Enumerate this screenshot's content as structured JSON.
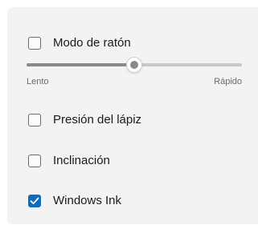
{
  "settings": {
    "mouse_mode": {
      "label": "Modo de ratón",
      "checked": false
    },
    "speed_slider": {
      "min_label": "Lento",
      "max_label": "Rápido",
      "value_percent": 50
    },
    "pen_pressure": {
      "label": "Presión del lápiz",
      "checked": false
    },
    "tilt": {
      "label": "Inclinación",
      "checked": false
    },
    "windows_ink": {
      "label": "Windows Ink",
      "checked": true
    }
  },
  "colors": {
    "panel_background": "#f3f3f3",
    "accent": "#0f6cbd",
    "slider_active": "#8a8a8a",
    "slider_inactive": "#c8c8c8"
  }
}
